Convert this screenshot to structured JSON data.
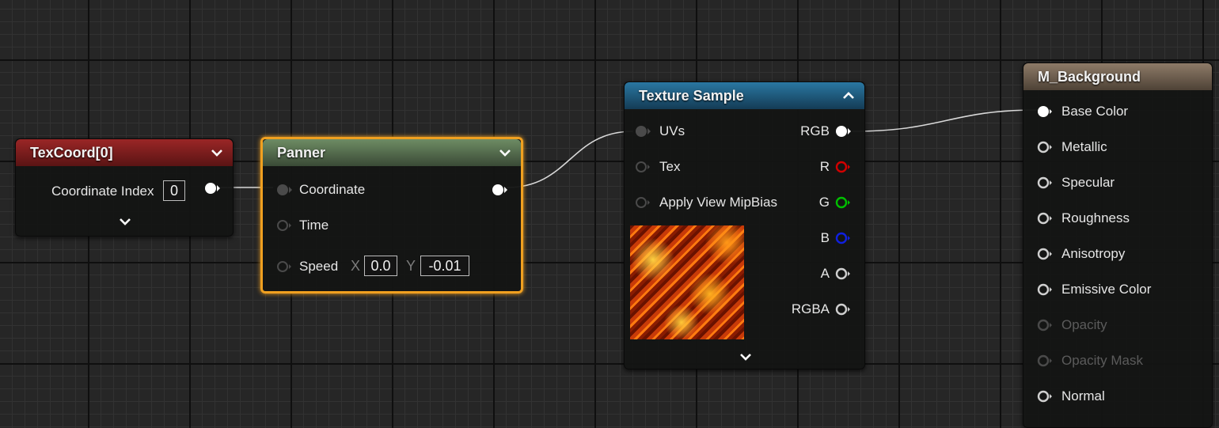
{
  "texcoord": {
    "title": "TexCoord[0]",
    "coordinate_index_label": "Coordinate Index",
    "coordinate_index_value": "0"
  },
  "panner": {
    "title": "Panner",
    "coordinate_label": "Coordinate",
    "time_label": "Time",
    "speed_label": "Speed",
    "x_axis": "X",
    "x_value": "0.0",
    "y_axis": "Y",
    "y_value": "-0.01"
  },
  "texture_sample": {
    "title": "Texture Sample",
    "inputs": [
      "UVs",
      "Tex",
      "Apply View MipBias"
    ],
    "outputs": [
      "RGB",
      "R",
      "G",
      "B",
      "A",
      "RGBA"
    ],
    "output_colors": [
      "#ffffff",
      "#d10000",
      "#00c000",
      "#1020e0",
      "#cfcfcf",
      "#cfcfcf"
    ]
  },
  "material": {
    "title": "M_Background",
    "inputs": [
      "Base Color",
      "Metallic",
      "Specular",
      "Roughness",
      "Anisotropy",
      "Emissive Color",
      "Opacity",
      "Opacity Mask",
      "Normal"
    ],
    "disabled": [
      false,
      false,
      false,
      false,
      false,
      false,
      true,
      true,
      false
    ]
  },
  "colors": {
    "texcoord_header": "#8c1c1c",
    "panner_header": "#5e7a55",
    "texture_header": "#1f5f82",
    "material_header": "#806e5c",
    "selection": "#f0a020"
  }
}
